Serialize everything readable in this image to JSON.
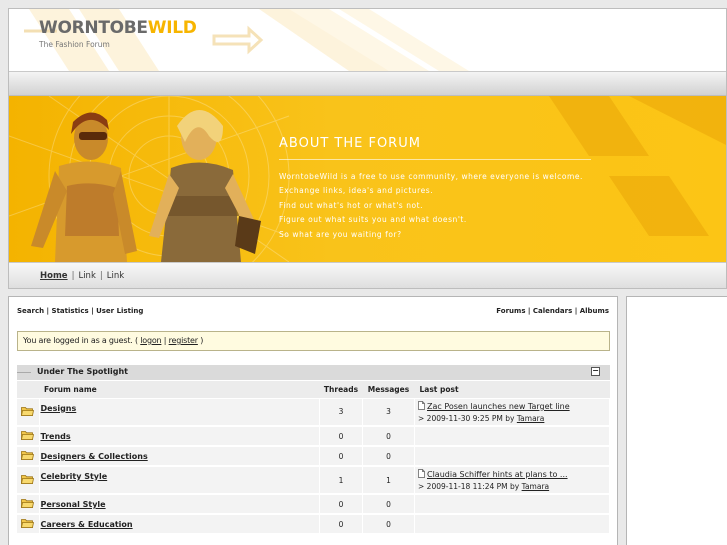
{
  "logo": {
    "part1": "WORNTOBE",
    "part2": "WILD",
    "tagline": "The Fashion Forum"
  },
  "banner": {
    "title": "ABOUT THE FORUM",
    "lines": [
      "WorntobeWild is a free to use community, where everyone is welcome.",
      "Exchange links, idea's and pictures.",
      "Find out what's hot or what's not.",
      "Figure out what suits you and what doesn't.",
      "So what are you waiting for?"
    ]
  },
  "nav": {
    "home": "Home",
    "sep": "|",
    "link1": "Link",
    "link2": "Link"
  },
  "toplinks": {
    "search": "Search",
    "statistics": "Statistics",
    "user_listing": "User Listing",
    "forums": "Forums",
    "calendars": "Calendars",
    "albums": "Albums",
    "sep": "|"
  },
  "guest": {
    "text_before": "You are logged in as a guest. (",
    "logon": "logon",
    "sep": "|",
    "register": "register",
    "text_after": ")"
  },
  "category": {
    "title": "Under The Spotlight",
    "collapse_symbol": "−"
  },
  "table": {
    "headers": {
      "forum": "Forum name",
      "threads": "Threads",
      "messages": "Messages",
      "last_post": "Last post"
    },
    "rows": [
      {
        "name": "Designs",
        "threads": "3",
        "messages": "3",
        "last_title": "Zac Posen launches new Target line",
        "last_prefix": "> 2009-11-30 9:25 PM by",
        "last_user": "Tamara"
      },
      {
        "name": "Trends",
        "threads": "0",
        "messages": "0",
        "last_title": "",
        "last_prefix": "",
        "last_user": ""
      },
      {
        "name": "Designers & Collections",
        "threads": "0",
        "messages": "0",
        "last_title": "",
        "last_prefix": "",
        "last_user": ""
      },
      {
        "name": "Celebrity Style",
        "threads": "1",
        "messages": "1",
        "last_title": "Claudia Schiffer hints at plans to ...",
        "last_prefix": "> 2009-11-18 11:24 PM by",
        "last_user": "Tamara"
      },
      {
        "name": "Personal Style",
        "threads": "0",
        "messages": "0",
        "last_title": "",
        "last_prefix": "",
        "last_user": ""
      },
      {
        "name": "Careers & Education",
        "threads": "0",
        "messages": "0",
        "last_title": "",
        "last_prefix": "",
        "last_user": ""
      }
    ]
  },
  "colors": {
    "brand_yellow": "#f7b500",
    "banner_yellow": "#f9c31a",
    "guest_bg": "#fffbe0"
  }
}
